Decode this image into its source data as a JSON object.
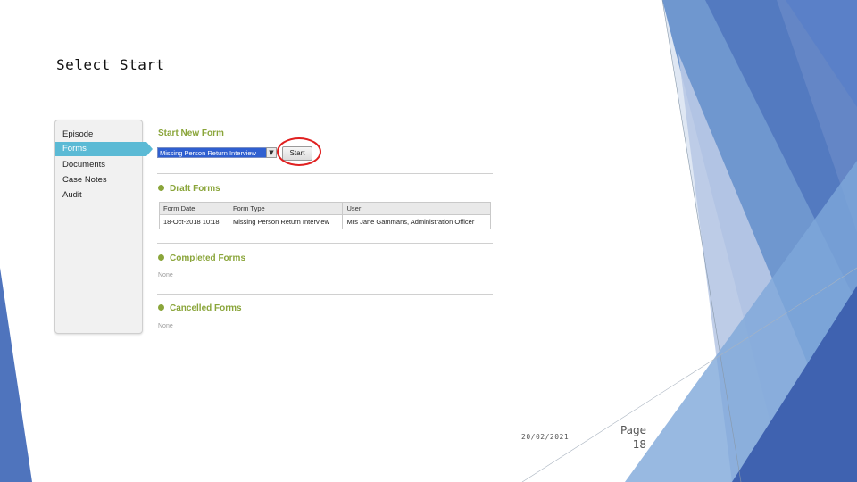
{
  "slide": {
    "title": "Select Start",
    "date": "20/02/2021",
    "page_label": "Page",
    "page_number": "18"
  },
  "sidebar": {
    "items": [
      {
        "label": "Episode",
        "active": false
      },
      {
        "label": "Forms",
        "active": true
      },
      {
        "label": "Documents",
        "active": false
      },
      {
        "label": "Case Notes",
        "active": false
      },
      {
        "label": "Audit",
        "active": false
      }
    ]
  },
  "start_form": {
    "title": "Start New Form",
    "selected_value": "Missing Person Return Interview",
    "start_label": "Start"
  },
  "draft_forms": {
    "title": "Draft Forms",
    "headers": [
      "Form Date",
      "Form Type",
      "User"
    ],
    "rows": [
      [
        "18-Oct-2018 10:18",
        "Missing Person Return Interview",
        "Mrs Jane Gammans, Administration Officer"
      ]
    ]
  },
  "completed_forms": {
    "title": "Completed Forms",
    "empty_text": "None"
  },
  "cancelled_forms": {
    "title": "Cancelled Forms",
    "empty_text": "None"
  },
  "colors": {
    "accent_green": "#8aa53a",
    "nav_active": "#5bbad5",
    "highlight_circle": "#e02020",
    "deco_blue": "#4f6fb6"
  }
}
